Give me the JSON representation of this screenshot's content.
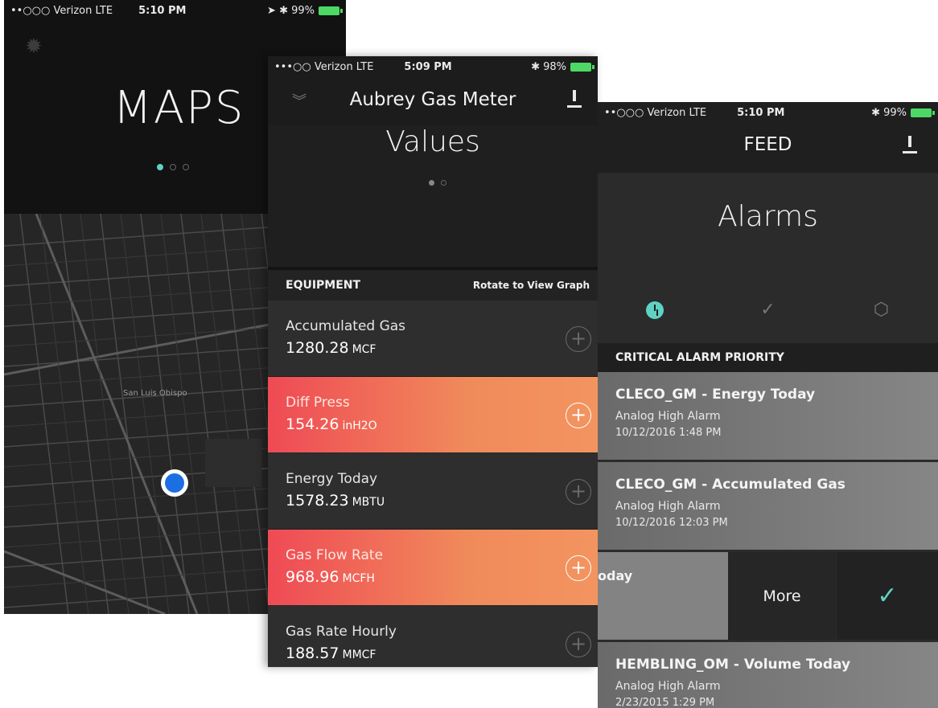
{
  "maps_screen": {
    "status": {
      "carrier": "••○○○ Verizon  LTE",
      "time": "5:10 PM",
      "right": "➤ ✱ 99%"
    },
    "title": "MAPS",
    "map_label": "San Luis Obispo"
  },
  "values_screen": {
    "status": {
      "carrier": "•••○○ Verizon  LTE",
      "time": "5:09 PM",
      "right": "✱ 98%"
    },
    "nav_title": "Aubrey Gas Meter",
    "hero_title": "Values",
    "section_left": "EQUIPMENT",
    "section_right": "Rotate to View Graph",
    "rows": [
      {
        "name": "Accumulated Gas",
        "value": "1280.28",
        "unit": "MCF",
        "alert": false
      },
      {
        "name": "Diff Press",
        "value": "154.26",
        "unit": "inH2O",
        "alert": true
      },
      {
        "name": "Energy Today",
        "value": "1578.23",
        "unit": "MBTU",
        "alert": false
      },
      {
        "name": "Gas Flow Rate",
        "value": "968.96",
        "unit": "MCFH",
        "alert": true
      },
      {
        "name": "Gas Rate Hourly",
        "value": "188.57",
        "unit": "MMCF",
        "alert": false
      }
    ]
  },
  "feed_screen": {
    "status": {
      "carrier": "••○○○ Verizon  LTE",
      "time": "5:10 PM",
      "right": "✱ 99%"
    },
    "nav_title": "FEED",
    "hero_title": "Alarms",
    "section_title": "CRITICAL ALARM PRIORITY",
    "items": [
      {
        "title": "CLECO_GM - Energy Today",
        "subtitle": "Analog High Alarm",
        "date": "10/12/2016 1:48 PM"
      },
      {
        "title": "CLECO_GM - Accumulated Gas",
        "subtitle": "Analog High Alarm",
        "date": "10/12/2016 12:03 PM"
      }
    ],
    "swiped": {
      "partial_text": "oday",
      "more_label": "More",
      "ack_icon": "✓"
    },
    "last_item": {
      "title": "HEMBLING_OM - Volume Today",
      "subtitle": "Analog High Alarm",
      "date": "2/23/2015 1:29 PM"
    }
  },
  "colors": {
    "accent": "#5fd2c4",
    "alert_start": "#ef4a55",
    "alert_end": "#f39460",
    "location": "#1c6fe3"
  }
}
